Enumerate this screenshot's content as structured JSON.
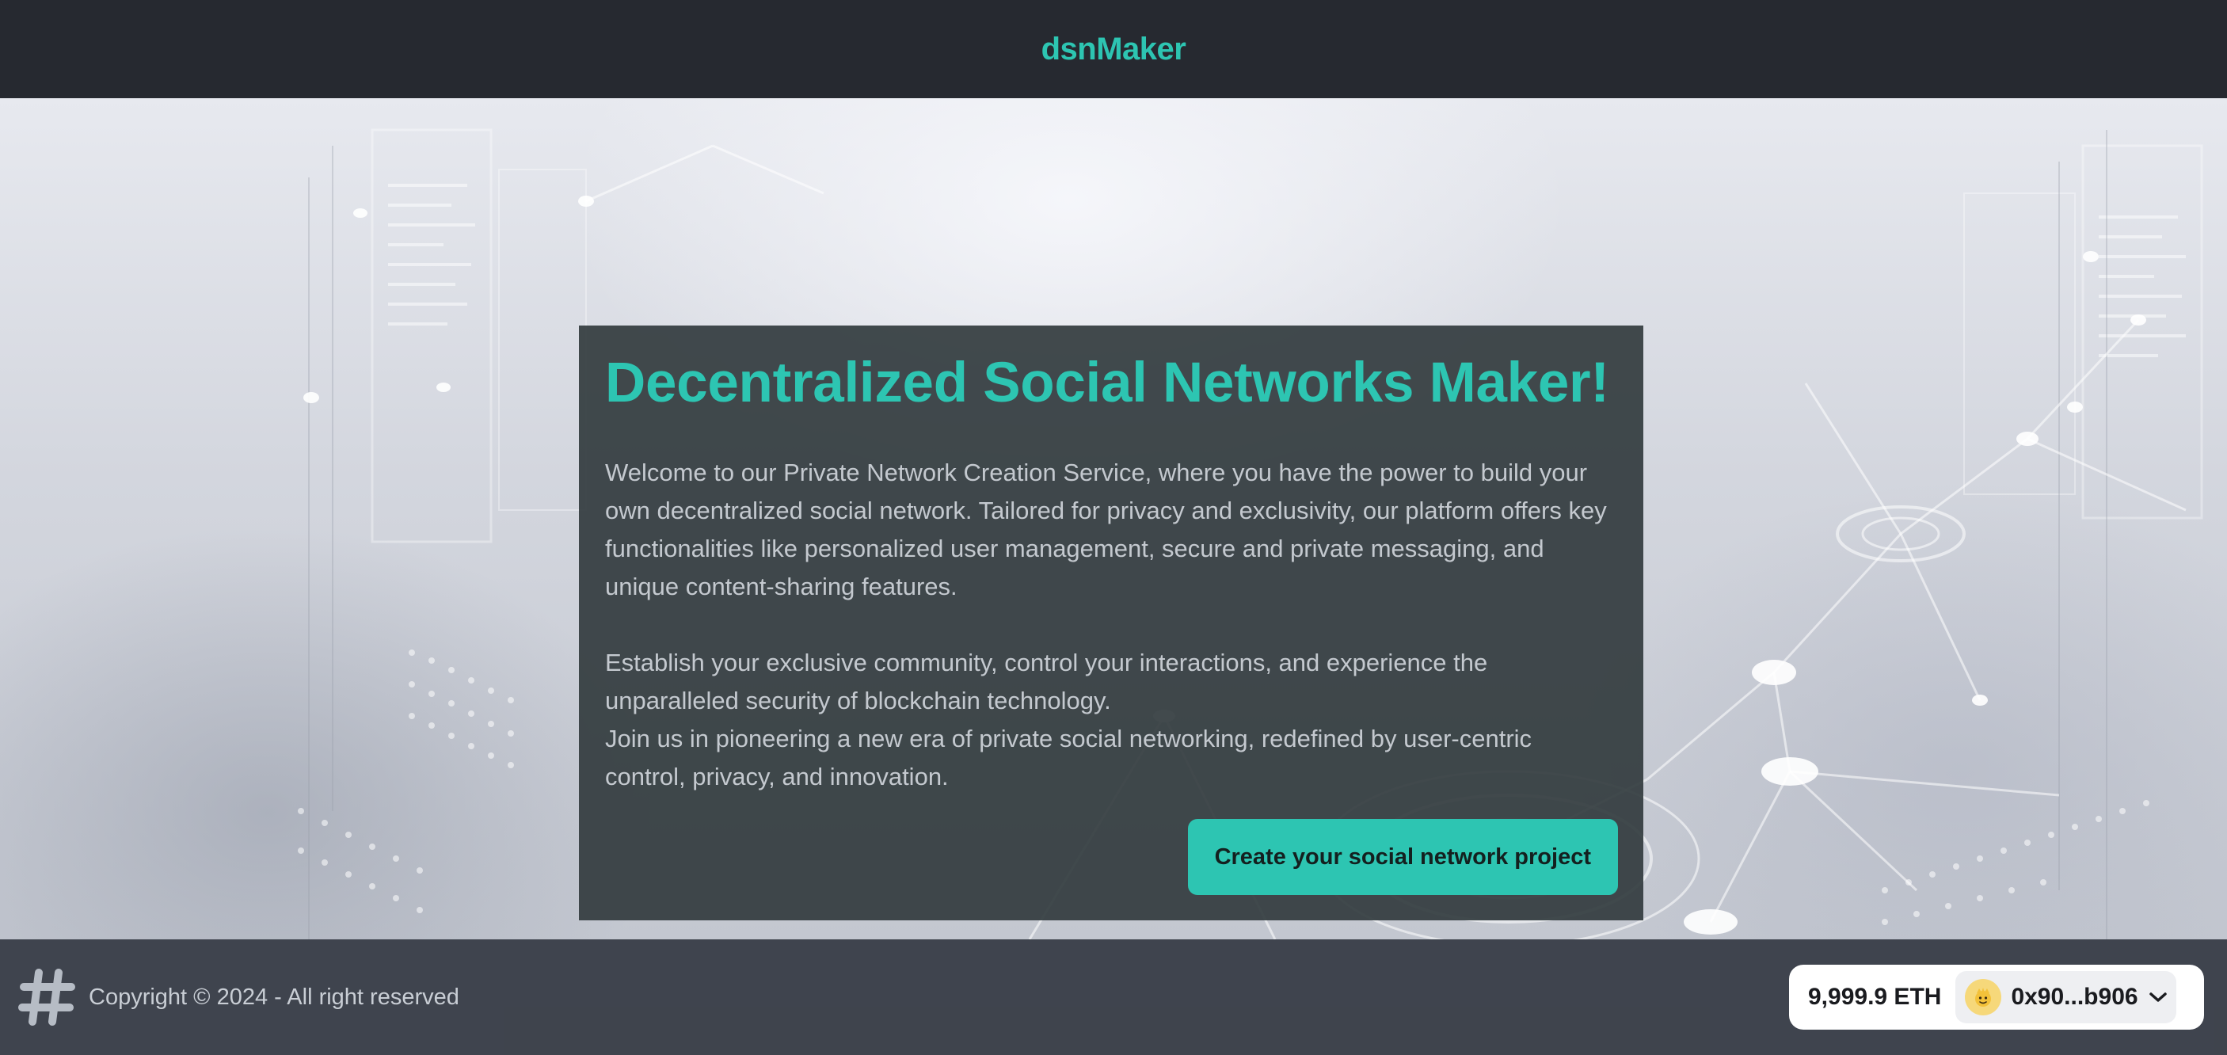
{
  "header": {
    "brand": "dsnMaker"
  },
  "hero": {
    "title": "Decentralized Social Networks Maker!",
    "paragraphs": [
      "Welcome to our Private Network Creation Service, where you have the power to build your own decentralized social network. Tailored for privacy and exclusivity, our platform offers key functionalities like personalized user management, secure and private messaging, and unique content-sharing features.",
      "Establish your exclusive community, control your interactions, and experience the unparalleled security of blockchain technology.",
      "Join us in pioneering a new era of private social networking, redefined by user-centric control, privacy, and innovation."
    ],
    "cta_label": "Create your social network project"
  },
  "footer": {
    "logo_icon": "hashtag-icon",
    "copyright": "Copyright © 2024 - All right reserved",
    "wallet": {
      "balance": "9,999.9 ETH",
      "address": "0x90...b906",
      "avatar_icon": "emoji-avatar-icon",
      "dropdown_icon": "chevron-down-icon"
    }
  },
  "colors": {
    "accent": "#2dc5b2",
    "header_bg": "#262930",
    "footer_bg": "#3a3f48",
    "card_bg": "#343c40"
  }
}
